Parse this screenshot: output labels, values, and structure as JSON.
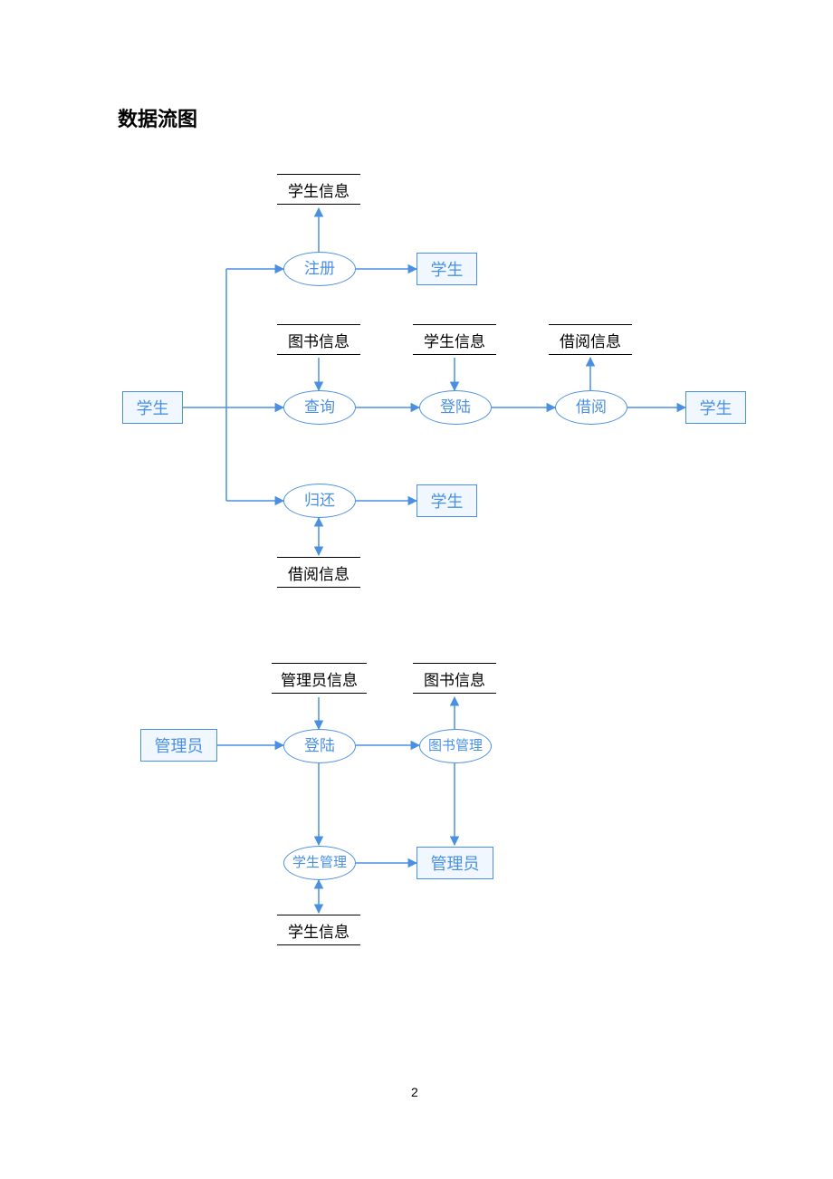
{
  "title": "数据流图",
  "page_number": "2",
  "colors": {
    "accent": "#4a90e2",
    "entity_fill": "#f0f7ff"
  },
  "diagram1": {
    "entities": {
      "student_left": "学生",
      "student_top_right": "学生",
      "student_mid_right": "学生",
      "student_far_right": "学生"
    },
    "processes": {
      "register": "注册",
      "query": "查询",
      "login": "登陆",
      "borrow": "借阅",
      "return": "归还"
    },
    "datastores": {
      "student_info_top": "学生信息",
      "book_info": "图书信息",
      "student_info_mid": "学生信息",
      "borrow_info_top": "借阅信息",
      "borrow_info_bottom": "借阅信息"
    }
  },
  "diagram2": {
    "entities": {
      "admin_left": "管理员",
      "admin_right": "管理员"
    },
    "processes": {
      "login": "登陆",
      "book_mgmt": "图书管理",
      "student_mgmt": "学生管理"
    },
    "datastores": {
      "admin_info": "管理员信息",
      "book_info": "图书信息",
      "student_info": "学生信息"
    }
  }
}
